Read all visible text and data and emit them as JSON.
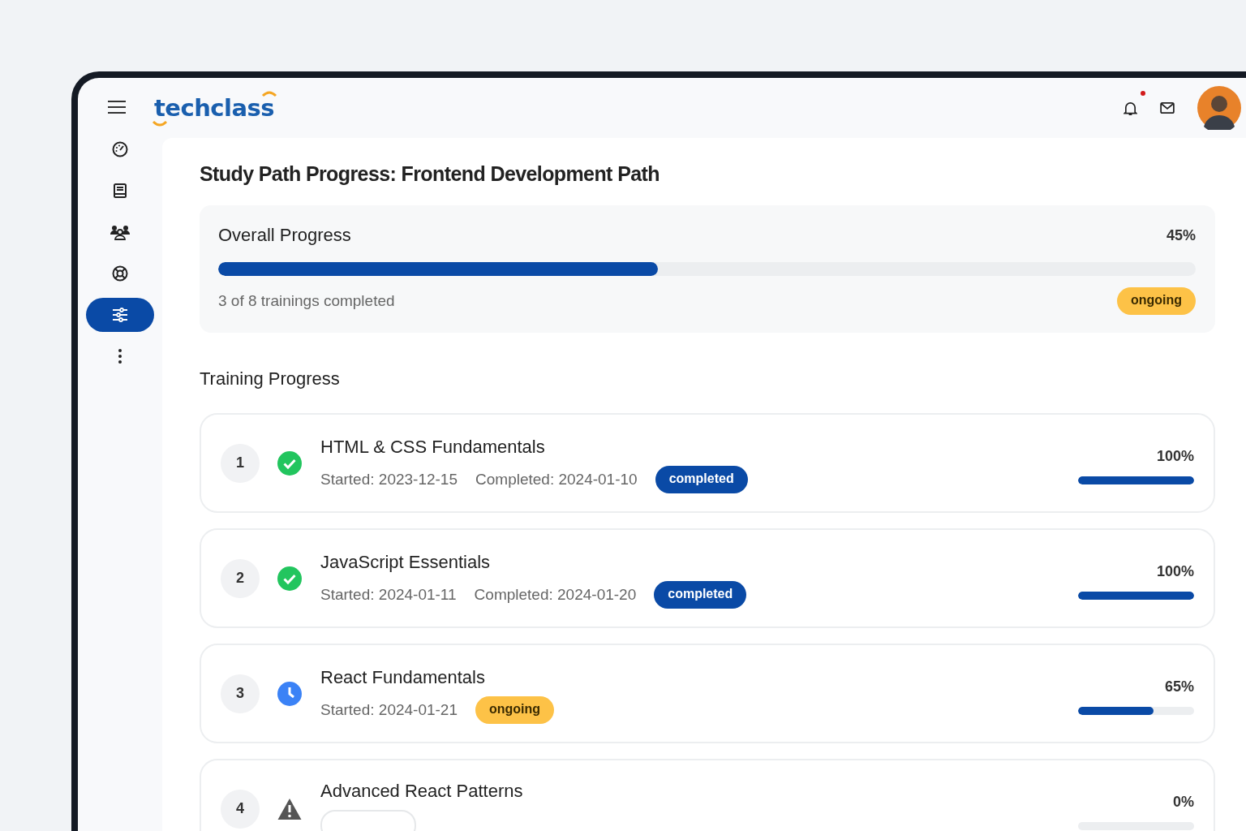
{
  "header": {
    "logo": "techclass",
    "notification_dot": true
  },
  "sidebar": {
    "items": [
      {
        "kind": "dashboard",
        "selected": false
      },
      {
        "kind": "book",
        "selected": false
      },
      {
        "kind": "people",
        "selected": false
      },
      {
        "kind": "support",
        "selected": false
      },
      {
        "kind": "sliders",
        "selected": true
      },
      {
        "kind": "more",
        "selected": false
      }
    ]
  },
  "page_title": "Study Path Progress: Frontend Development Path",
  "overall": {
    "label": "Overall Progress",
    "percent": "45%",
    "level": 0.45,
    "summary": "3 of 8 trainings completed",
    "badge": {
      "text": "ongoing",
      "kind": "ongoing"
    }
  },
  "section_title": "Training Progress",
  "trainings": [
    {
      "number": "1",
      "kind": "completed",
      "title": "HTML & CSS Fundamentals",
      "started": "Started: 2023-12-15",
      "completed": "Completed: 2024-01-10",
      "badge": "completed",
      "percent": "100%",
      "level": 1
    },
    {
      "number": "2",
      "kind": "completed",
      "title": "JavaScript Essentials",
      "started": "Started: 2024-01-11",
      "completed": "Completed: 2024-01-20",
      "badge": "completed",
      "percent": "100%",
      "level": 1
    },
    {
      "number": "3",
      "kind": "ongoing",
      "title": "React Fundamentals",
      "started": "Started: 2024-01-21",
      "badge": "ongoing",
      "percent": "65%",
      "level": 0.65
    },
    {
      "number": "4",
      "kind": "locked",
      "title": "Advanced React Patterns",
      "percent": "0%"
    }
  ]
}
